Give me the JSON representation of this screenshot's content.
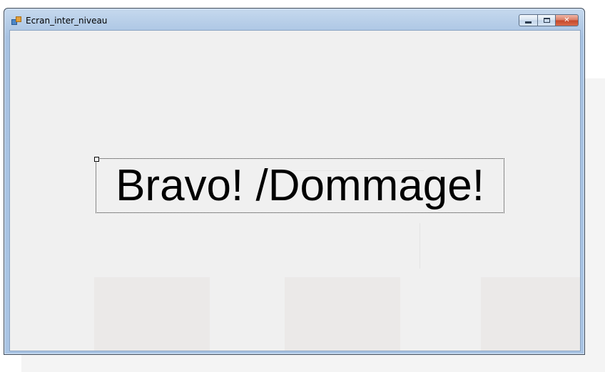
{
  "window": {
    "title": "Ecran_inter_niveau",
    "icon": "app-form-icon",
    "controls": {
      "minimize": "minimize-icon",
      "maximize": "maximize-icon",
      "close": "close-icon"
    }
  },
  "main": {
    "result_label": "Bravo! /Dommage!"
  }
}
